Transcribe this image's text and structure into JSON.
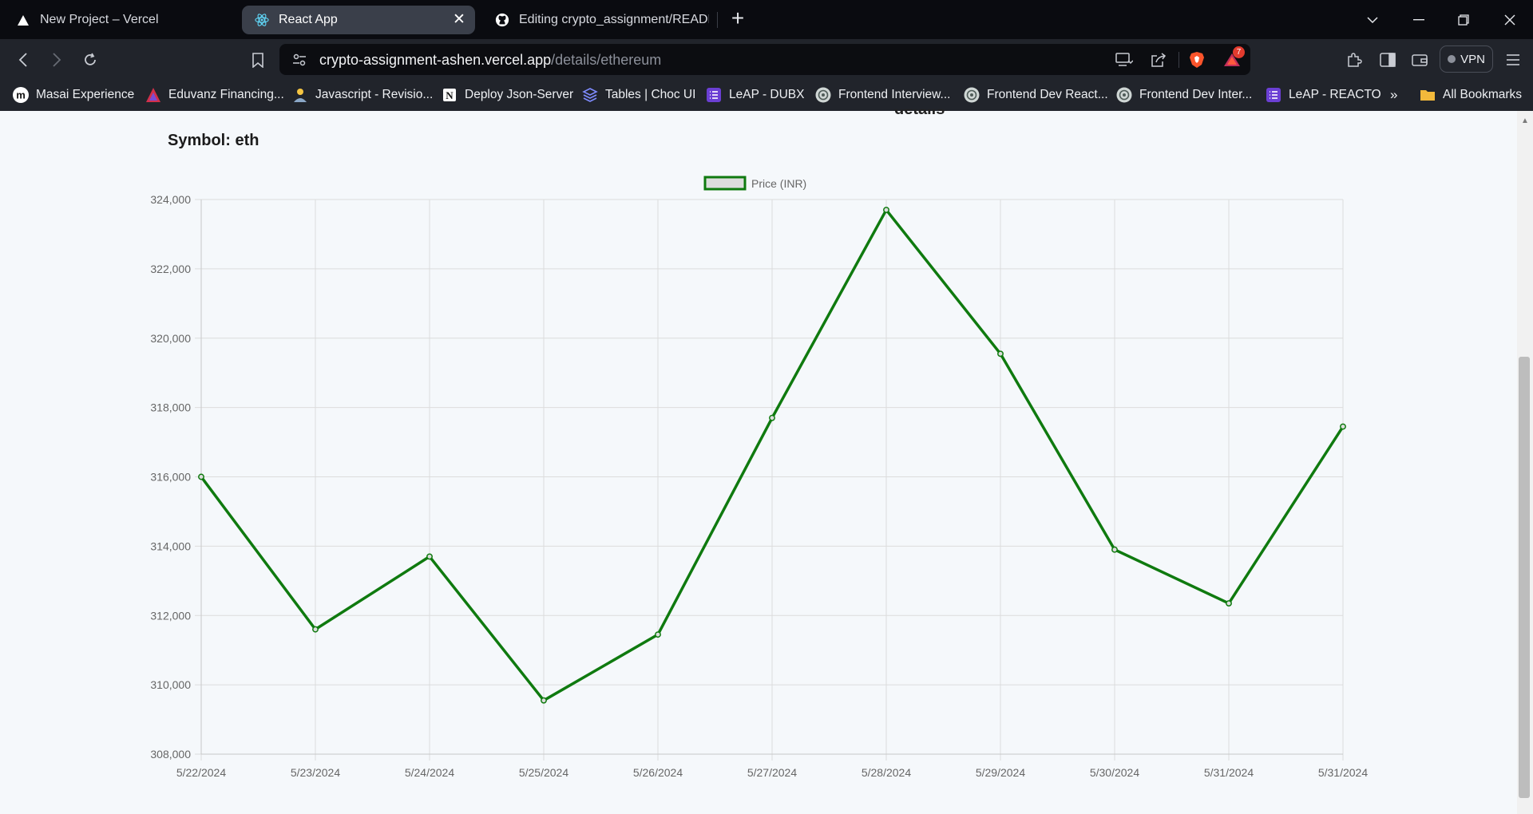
{
  "browser": {
    "tabs": [
      {
        "title": "New Project – Vercel",
        "icon": "vercel-icon"
      },
      {
        "title": "React App",
        "icon": "react-icon",
        "active": true
      },
      {
        "title": "Editing crypto_assignment/README.md",
        "icon": "github-icon"
      }
    ],
    "address": {
      "host": "crypto-assignment-ashen.vercel.app",
      "path": "/details/ethereum"
    },
    "notification_count": "7",
    "vpn_label": "VPN",
    "bookmarks": [
      {
        "label": "Masai Experience",
        "icon": "masai-icon"
      },
      {
        "label": "Eduvanz Financing...",
        "icon": "eduvanz-icon"
      },
      {
        "label": "Javascript - Revisio...",
        "icon": "person-icon"
      },
      {
        "label": "Deploy Json-Server",
        "icon": "notion-icon"
      },
      {
        "label": "Tables | Choc UI",
        "icon": "layers-icon"
      },
      {
        "label": "LeAP - DUBX",
        "icon": "list-icon"
      },
      {
        "label": "Frontend Interview...",
        "icon": "chatgpt-icon"
      },
      {
        "label": "Frontend Dev React...",
        "icon": "chatgpt-icon"
      },
      {
        "label": "Frontend Dev Inter...",
        "icon": "chatgpt-icon"
      },
      {
        "label": "LeAP - REACTO",
        "icon": "list-icon"
      }
    ],
    "bookmarks_overflow": "»",
    "all_bookmarks_label": "All Bookmarks"
  },
  "page": {
    "cut_heading": "details",
    "symbol_text": "Symbol: eth"
  },
  "chart_data": {
    "type": "line",
    "series": [
      {
        "name": "Price (INR)",
        "color": "#0f7a0f",
        "values": [
          316000,
          311600,
          313700,
          309550,
          311450,
          317700,
          323700,
          319550,
          313900,
          312350,
          317450
        ]
      }
    ],
    "categories": [
      "5/22/2024",
      "5/23/2024",
      "5/24/2024",
      "5/25/2024",
      "5/26/2024",
      "5/27/2024",
      "5/28/2024",
      "5/29/2024",
      "5/30/2024",
      "5/31/2024",
      "5/31/2024"
    ],
    "yticks": [
      "308,000",
      "310,000",
      "312,000",
      "314,000",
      "316,000",
      "318,000",
      "320,000",
      "322,000",
      "324,000"
    ],
    "ylim": [
      308000,
      324000
    ],
    "grid": true,
    "legend": "top-center"
  }
}
